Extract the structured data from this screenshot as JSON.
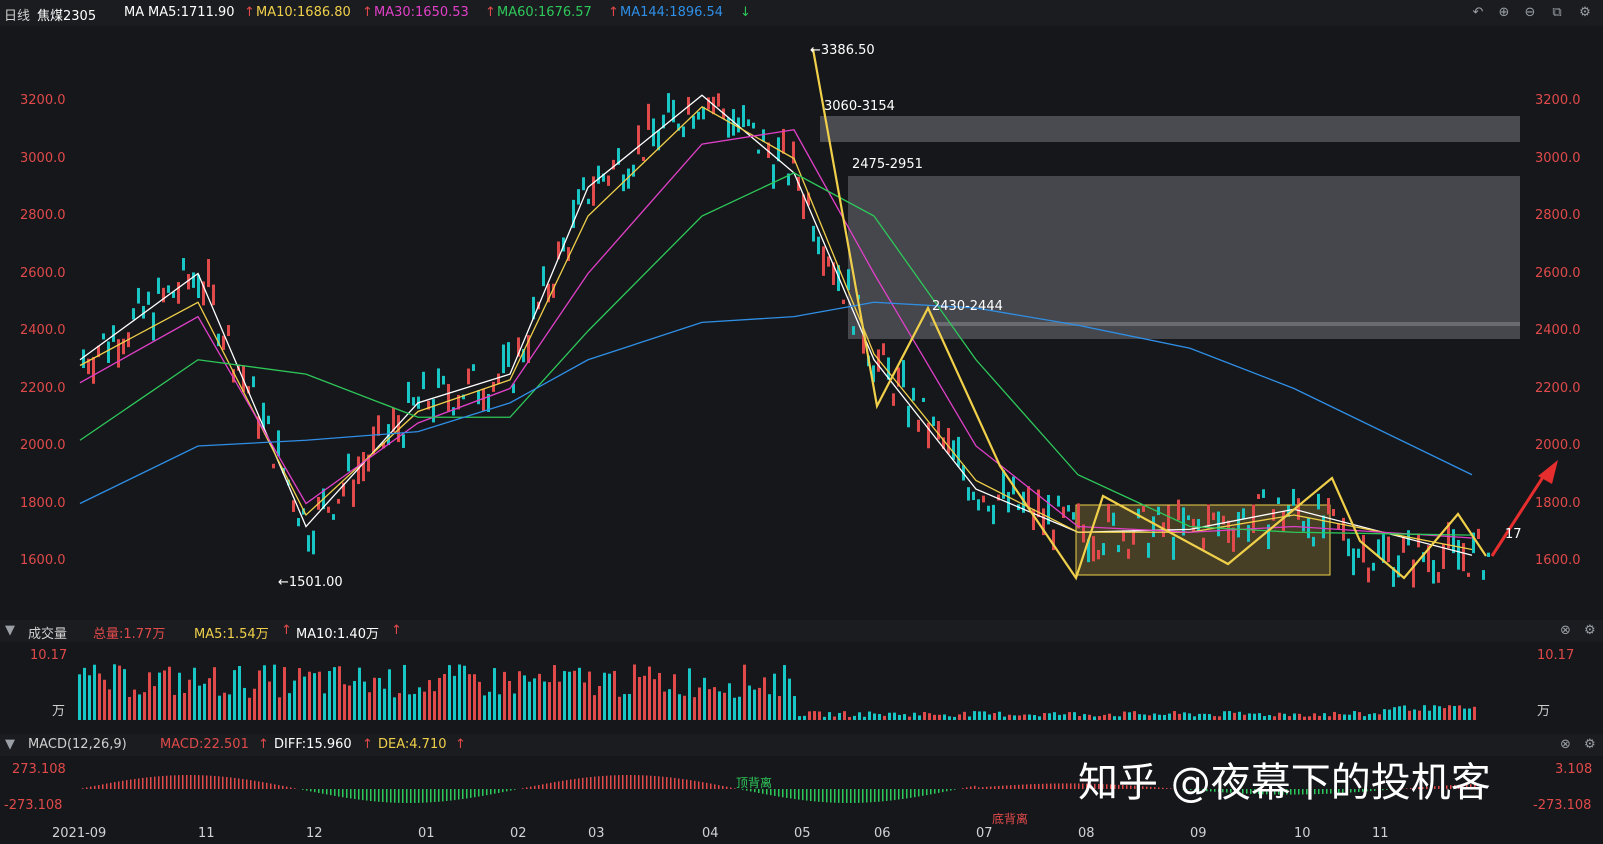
{
  "header": {
    "period": "日线",
    "symbol": "焦煤2305",
    "ma_label": "MA",
    "ma5": "MA5:1711.90",
    "ma10": "MA10:1686.80",
    "ma30": "MA30:1650.53",
    "ma60": "MA60:1676.57",
    "ma144": "MA144:1896.54",
    "up_arrow": "↑",
    "down_arrow": "↓"
  },
  "colors": {
    "ma5": "#ffffff",
    "ma10": "#f0d04a",
    "ma30": "#e040c8",
    "ma60": "#2ec85a",
    "ma144": "#2f8fe6",
    "up": "#e04a4a",
    "down": "#19c6c6",
    "zone": "#3a3b3f",
    "box": "#f0d04a"
  },
  "toolbar_icons": [
    "undo-icon",
    "zoom-in-icon",
    "zoom-out-icon",
    "window-icon",
    "settings-icon"
  ],
  "price_axis": {
    "ticks": [
      "3200.0",
      "3000.0",
      "2800.0",
      "2600.0",
      "2400.0",
      "2200.0",
      "2000.0",
      "1800.0",
      "1600.0"
    ],
    "values": [
      3200,
      3000,
      2800,
      2600,
      2400,
      2200,
      2000,
      1800,
      1600
    ]
  },
  "annotations": {
    "high": "←3386.50",
    "low": "←1501.00",
    "zone1": "3060-3154",
    "zone2": "2475-2951",
    "zone3": "2430-2444",
    "right_cut": "17"
  },
  "volume_panel": {
    "title": "成交量",
    "total": "总量:1.77万",
    "ma5": "MA5:1.54万",
    "ma10": "MA10:1.40万",
    "max": "10.17",
    "unit": "万"
  },
  "macd_panel": {
    "title": "MACD(12,26,9)",
    "macd": "MACD:22.501",
    "diff": "DIFF:15.960",
    "dea": "DEA:4.710",
    "top": "273.108",
    "bottom": "-273.108",
    "top_right": "3.108",
    "div_top": "顶背离",
    "div_bottom": "底背离"
  },
  "x_axis": [
    "2021-09",
    "11",
    "12",
    "01",
    "02",
    "03",
    "04",
    "05",
    "06",
    "07",
    "08",
    "09",
    "10",
    "11"
  ],
  "watermark": "知乎 @夜幕下的投机客",
  "chart_data": {
    "type": "line",
    "title": "焦煤2305",
    "x": [
      "2021-09",
      "11",
      "12",
      "01",
      "02",
      "03",
      "04",
      "05",
      "06",
      "07",
      "08",
      "09",
      "10",
      "11"
    ],
    "series": [
      {
        "name": "MA5",
        "values": [
          2300,
          2600,
          1720,
          2150,
          2250,
          2900,
          3220,
          2950,
          2300,
          1850,
          1700,
          1710,
          1780,
          1620
        ]
      },
      {
        "name": "MA10",
        "values": [
          2280,
          2500,
          1760,
          2120,
          2230,
          2800,
          3180,
          3000,
          2320,
          1880,
          1700,
          1700,
          1760,
          1640
        ]
      },
      {
        "name": "MA30",
        "values": [
          2220,
          2450,
          1800,
          2080,
          2200,
          2600,
          3050,
          3100,
          2600,
          2000,
          1720,
          1700,
          1720,
          1680
        ]
      },
      {
        "name": "MA60",
        "values": [
          2020,
          2300,
          2250,
          2100,
          2100,
          2400,
          2800,
          2950,
          2800,
          2300,
          1900,
          1720,
          1700,
          1690
        ]
      },
      {
        "name": "MA144",
        "values": [
          1800,
          2000,
          2020,
          2050,
          2150,
          2300,
          2430,
          2450,
          2500,
          2480,
          2420,
          2340,
          2200,
          1900
        ]
      }
    ],
    "high": 3386.5,
    "low": 1501.0,
    "zones": [
      [
        3060,
        3154
      ],
      [
        2475,
        2951
      ],
      [
        2430,
        2444
      ]
    ],
    "ylim": [
      1500,
      3400
    ]
  }
}
